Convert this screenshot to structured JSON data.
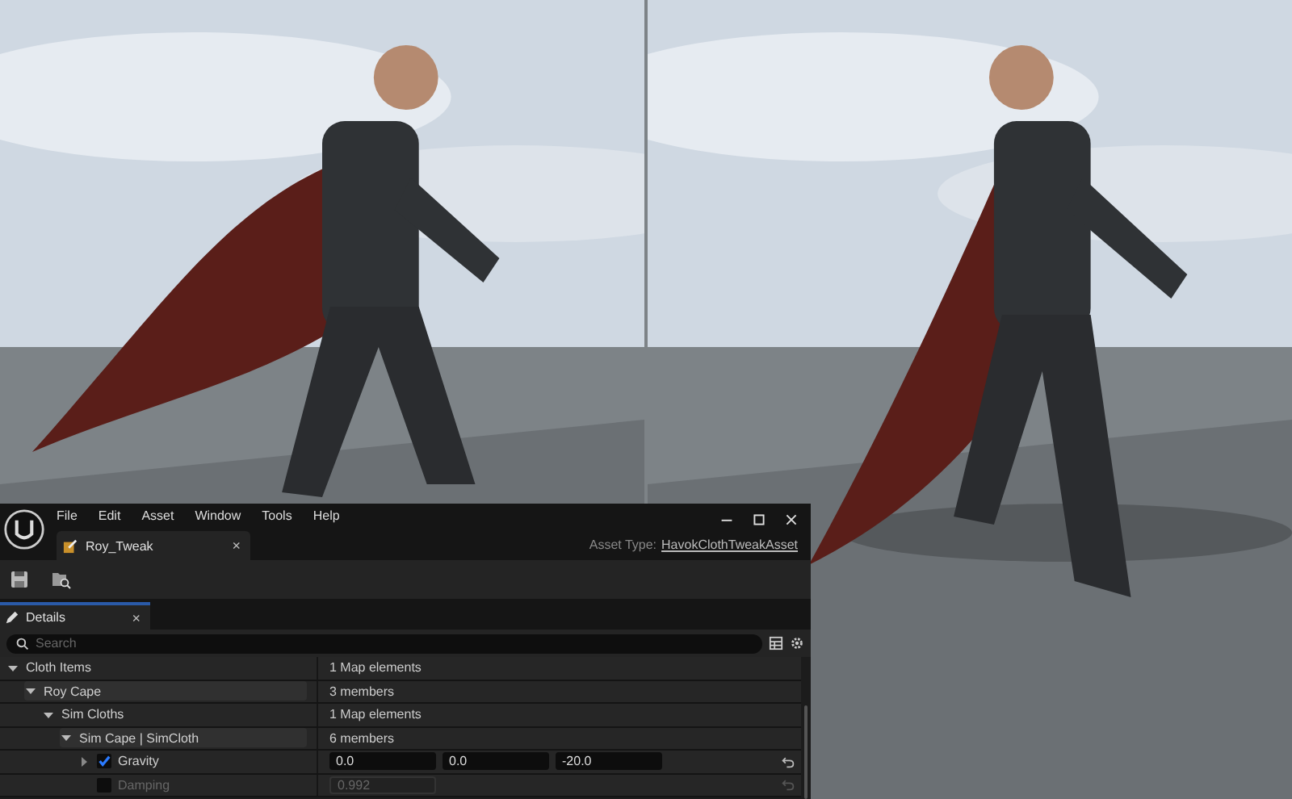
{
  "editor": {
    "menu": [
      "File",
      "Edit",
      "Asset",
      "Window",
      "Tools",
      "Help"
    ],
    "document_tab": {
      "label": "Roy_Tweak",
      "close": "×"
    },
    "asset_type": {
      "label": "Asset Type:",
      "value": "HavokClothTweakAsset"
    },
    "details_tab": {
      "label": "Details",
      "close": "×"
    },
    "search": {
      "placeholder": "Search"
    },
    "properties": [
      {
        "kind": "group",
        "name": "Cloth Items",
        "value": "1 Map elements",
        "expanded": true,
        "children": [
          {
            "kind": "group",
            "name": "Roy Cape",
            "value": "3 members",
            "expanded": true,
            "children": [
              {
                "kind": "group",
                "name": "Sim Cloths",
                "value": "1 Map elements",
                "expanded": true,
                "children": [
                  {
                    "kind": "group",
                    "name": "Sim Cape | SimCloth",
                    "value": "6 members",
                    "expanded": true,
                    "children": [
                      {
                        "kind": "vector",
                        "name": "Gravity",
                        "checked": true,
                        "expanded": false,
                        "values": [
                          "0.0",
                          "0.0",
                          "-20.0"
                        ]
                      },
                      {
                        "kind": "number",
                        "name": "Damping",
                        "checked": false,
                        "disabled": true,
                        "value": "0.992"
                      }
                    ]
                  }
                ]
              }
            ]
          }
        ]
      }
    ]
  }
}
